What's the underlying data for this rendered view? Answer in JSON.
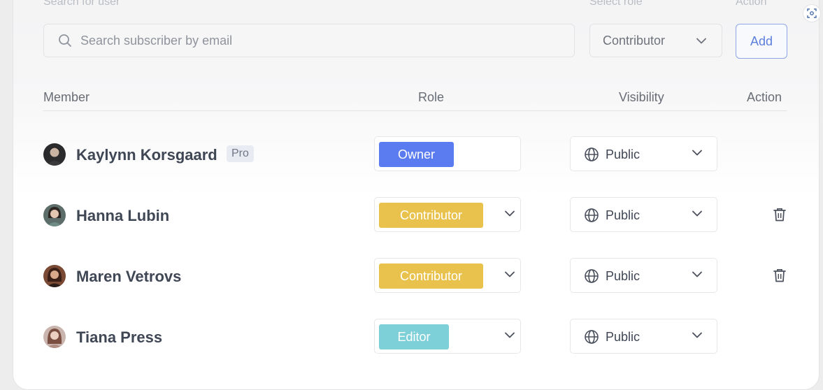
{
  "form": {
    "search_label": "Search for user",
    "search_placeholder": "Search subscriber by email",
    "role_label": "Select role",
    "role_value": "Contributor",
    "action_label": "Action",
    "add_label": "Add"
  },
  "table": {
    "headers": {
      "member": "Member",
      "role": "Role",
      "visibility": "Visibility",
      "action": "Action"
    },
    "rows": [
      {
        "name": "Kaylynn Korsgaard",
        "badge": "Pro",
        "role": "Owner",
        "role_color": "#5b7cf0",
        "role_dropdown": false,
        "visibility": "Public",
        "deletable": false
      },
      {
        "name": "Hanna Lubin",
        "badge": "",
        "role": "Contributor",
        "role_color": "#e9c24d",
        "role_dropdown": true,
        "visibility": "Public",
        "deletable": true
      },
      {
        "name": "Maren Vetrovs",
        "badge": "",
        "role": "Contributor",
        "role_color": "#e9c24d",
        "role_dropdown": true,
        "visibility": "Public",
        "deletable": true
      },
      {
        "name": "Tiana Press",
        "badge": "",
        "role": "Editor",
        "role_color": "#7dd0d8",
        "role_dropdown": true,
        "visibility": "Public",
        "deletable": false
      }
    ]
  },
  "icons": {
    "search": "search-icon",
    "chevron": "chevron-down-icon",
    "globe": "globe-icon",
    "trash": "trash-icon",
    "screenshot": "screenshot-icon"
  }
}
